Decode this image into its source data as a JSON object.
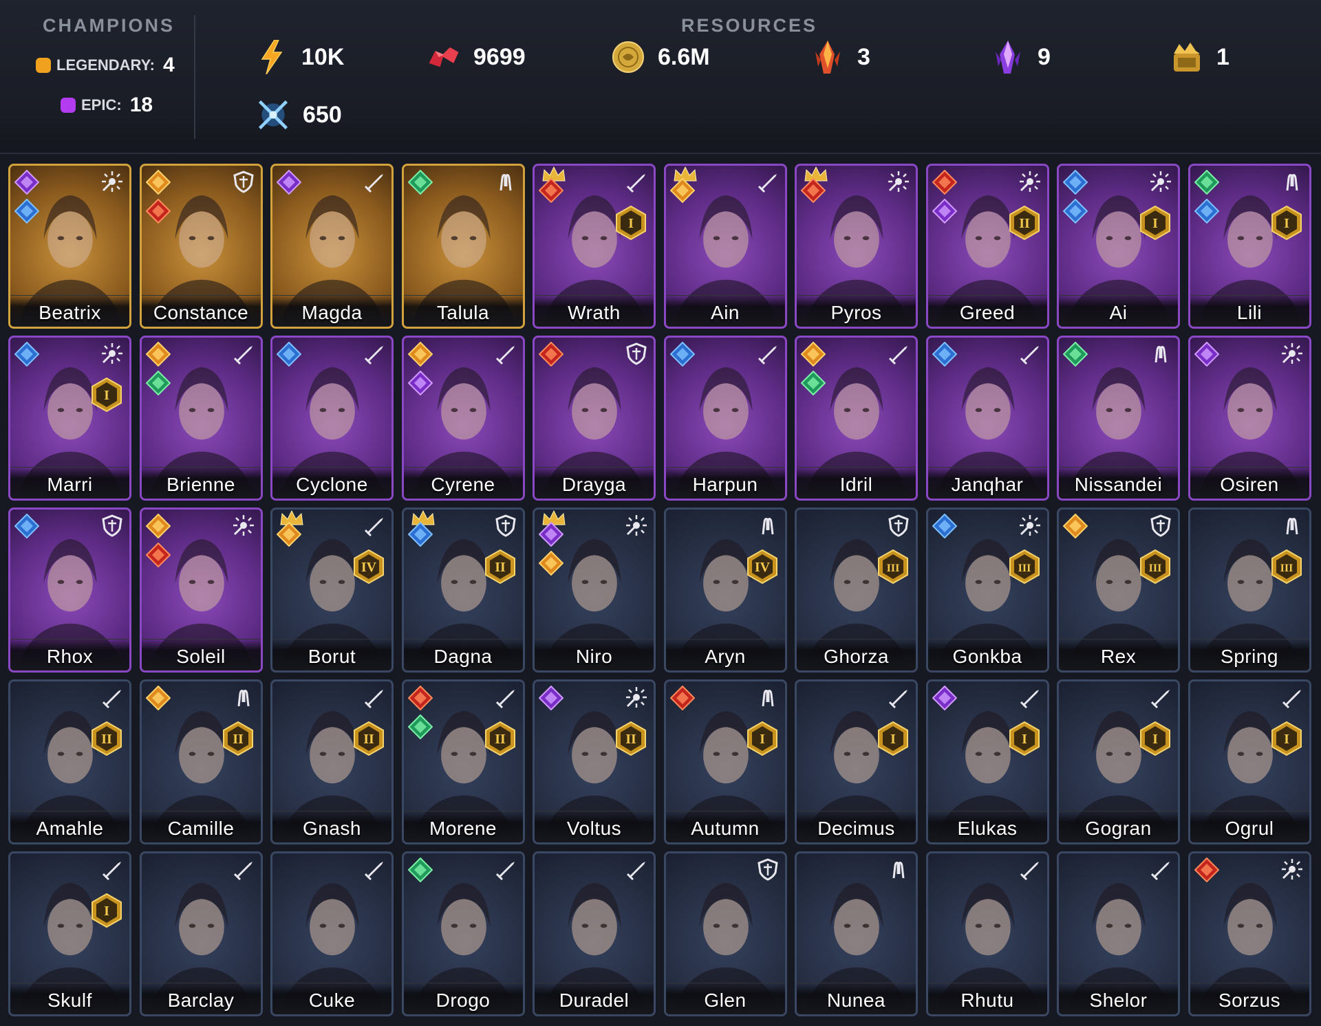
{
  "header": {
    "champions_label": "CHAMPIONS",
    "resources_label": "RESOURCES",
    "legendary": {
      "label": "LEGENDARY:",
      "count": "4",
      "color": "#f0a21e"
    },
    "epic": {
      "label": "EPIC:",
      "count": "18",
      "color": "#b43cf0"
    },
    "resources": [
      {
        "id": "energy",
        "icon": "energy-bolt-icon",
        "value": "10K"
      },
      {
        "id": "rubies",
        "icon": "ruby-gems-icon",
        "value": "9699"
      },
      {
        "id": "gold",
        "icon": "gold-coin-icon",
        "value": "6.6M"
      },
      {
        "id": "red-shard",
        "icon": "red-shard-icon",
        "value": "3"
      },
      {
        "id": "purple-shard",
        "icon": "purple-shard-icon",
        "value": "9"
      },
      {
        "id": "gold-token",
        "icon": "gold-token-icon",
        "value": "1"
      },
      {
        "id": "arena-tokens",
        "icon": "crossed-swords-icon",
        "value": "650"
      }
    ]
  },
  "champions": [
    {
      "name": "Beatrix",
      "rarity": "legendary",
      "role": "magic",
      "affinities": [
        "void",
        "magic"
      ],
      "rank": ""
    },
    {
      "name": "Constance",
      "rarity": "legendary",
      "role": "defense",
      "affinities": [
        "spirit",
        "force"
      ],
      "rank": ""
    },
    {
      "name": "Magda",
      "rarity": "legendary",
      "role": "attack",
      "affinities": [
        "void"
      ],
      "rank": ""
    },
    {
      "name": "Talula",
      "rarity": "legendary",
      "role": "support",
      "affinities": [
        "nature"
      ],
      "rank": ""
    },
    {
      "name": "Wrath",
      "rarity": "epic",
      "role": "attack",
      "affinities": [
        "force"
      ],
      "rank": "I",
      "crown": true
    },
    {
      "name": "Ain",
      "rarity": "epic",
      "role": "attack",
      "affinities": [
        "spirit"
      ],
      "rank": "",
      "crown": true
    },
    {
      "name": "Pyros",
      "rarity": "epic",
      "role": "magic",
      "affinities": [
        "force"
      ],
      "rank": "",
      "crown": true
    },
    {
      "name": "Greed",
      "rarity": "epic",
      "role": "magic",
      "affinities": [
        "force",
        "void"
      ],
      "rank": "II"
    },
    {
      "name": "Ai",
      "rarity": "epic",
      "role": "magic",
      "affinities": [
        "magic",
        "magic"
      ],
      "rank": "I"
    },
    {
      "name": "Lili",
      "rarity": "epic",
      "role": "support",
      "affinities": [
        "nature",
        "magic"
      ],
      "rank": "I"
    },
    {
      "name": "Marri",
      "rarity": "epic",
      "role": "magic",
      "affinities": [
        "magic"
      ],
      "rank": "I"
    },
    {
      "name": "Brienne",
      "rarity": "epic",
      "role": "attack",
      "affinities": [
        "spirit",
        "nature"
      ],
      "rank": ""
    },
    {
      "name": "Cyclone",
      "rarity": "epic",
      "role": "attack",
      "affinities": [
        "magic"
      ],
      "rank": ""
    },
    {
      "name": "Cyrene",
      "rarity": "epic",
      "role": "attack",
      "affinities": [
        "spirit",
        "void"
      ],
      "rank": ""
    },
    {
      "name": "Drayga",
      "rarity": "epic",
      "role": "defense",
      "affinities": [
        "force"
      ],
      "rank": ""
    },
    {
      "name": "Harpun",
      "rarity": "epic",
      "role": "attack",
      "affinities": [
        "magic"
      ],
      "rank": ""
    },
    {
      "name": "Idril",
      "rarity": "epic",
      "role": "attack",
      "affinities": [
        "spirit",
        "nature"
      ],
      "rank": ""
    },
    {
      "name": "Janqhar",
      "rarity": "epic",
      "role": "attack",
      "affinities": [
        "magic"
      ],
      "rank": ""
    },
    {
      "name": "Nissandei",
      "rarity": "epic",
      "role": "support",
      "affinities": [
        "nature"
      ],
      "rank": ""
    },
    {
      "name": "Osiren",
      "rarity": "epic",
      "role": "magic",
      "affinities": [
        "void"
      ],
      "rank": ""
    },
    {
      "name": "Rhox",
      "rarity": "epic",
      "role": "defense",
      "affinities": [
        "magic"
      ],
      "rank": ""
    },
    {
      "name": "Soleil",
      "rarity": "epic",
      "role": "magic",
      "affinities": [
        "spirit",
        "force"
      ],
      "rank": ""
    },
    {
      "name": "Borut",
      "rarity": "rare",
      "role": "attack",
      "affinities": [
        "spirit"
      ],
      "rank": "IV",
      "crown": true
    },
    {
      "name": "Dagna",
      "rarity": "rare",
      "role": "defense",
      "affinities": [
        "magic"
      ],
      "rank": "II",
      "crown": true
    },
    {
      "name": "Niro",
      "rarity": "rare",
      "role": "magic",
      "affinities": [
        "void",
        "spirit"
      ],
      "rank": "",
      "crown": true
    },
    {
      "name": "Aryn",
      "rarity": "rare",
      "role": "support",
      "affinities": [],
      "rank": "IV"
    },
    {
      "name": "Ghorza",
      "rarity": "rare",
      "role": "defense",
      "affinities": [],
      "rank": "III"
    },
    {
      "name": "Gonkba",
      "rarity": "rare",
      "role": "magic",
      "affinities": [
        "magic"
      ],
      "rank": "III"
    },
    {
      "name": "Rex",
      "rarity": "rare",
      "role": "defense",
      "affinities": [
        "spirit"
      ],
      "rank": "III"
    },
    {
      "name": "Spring",
      "rarity": "rare",
      "role": "support",
      "affinities": [],
      "rank": "III"
    },
    {
      "name": "Amahle",
      "rarity": "rare",
      "role": "attack",
      "affinities": [],
      "rank": "II"
    },
    {
      "name": "Camille",
      "rarity": "rare",
      "role": "support",
      "affinities": [
        "spirit"
      ],
      "rank": "II"
    },
    {
      "name": "Gnash",
      "rarity": "rare",
      "role": "attack",
      "affinities": [],
      "rank": "II"
    },
    {
      "name": "Morene",
      "rarity": "rare",
      "role": "attack",
      "affinities": [
        "force",
        "nature"
      ],
      "rank": "II"
    },
    {
      "name": "Voltus",
      "rarity": "rare",
      "role": "magic",
      "affinities": [
        "void"
      ],
      "rank": "II"
    },
    {
      "name": "Autumn",
      "rarity": "rare",
      "role": "support",
      "affinities": [
        "force"
      ],
      "rank": "I"
    },
    {
      "name": "Decimus",
      "rarity": "rare",
      "role": "attack",
      "affinities": [],
      "rank": "I"
    },
    {
      "name": "Elukas",
      "rarity": "rare",
      "role": "attack",
      "affinities": [
        "void"
      ],
      "rank": "I"
    },
    {
      "name": "Gogran",
      "rarity": "rare",
      "role": "attack",
      "affinities": [],
      "rank": "I"
    },
    {
      "name": "Ogrul",
      "rarity": "rare",
      "role": "attack",
      "affinities": [],
      "rank": "I"
    },
    {
      "name": "Skulf",
      "rarity": "rare",
      "role": "attack",
      "affinities": [],
      "rank": "I"
    },
    {
      "name": "Barclay",
      "rarity": "rare",
      "role": "attack",
      "affinities": [],
      "rank": ""
    },
    {
      "name": "Cuke",
      "rarity": "rare",
      "role": "attack",
      "affinities": [],
      "rank": ""
    },
    {
      "name": "Drogo",
      "rarity": "rare",
      "role": "attack",
      "affinities": [
        "nature"
      ],
      "rank": ""
    },
    {
      "name": "Duradel",
      "rarity": "rare",
      "role": "attack",
      "affinities": [],
      "rank": ""
    },
    {
      "name": "Glen",
      "rarity": "rare",
      "role": "defense",
      "affinities": [],
      "rank": ""
    },
    {
      "name": "Nunea",
      "rarity": "rare",
      "role": "support",
      "affinities": [],
      "rank": ""
    },
    {
      "name": "Rhutu",
      "rarity": "rare",
      "role": "attack",
      "affinities": [],
      "rank": ""
    },
    {
      "name": "Shelor",
      "rarity": "rare",
      "role": "attack",
      "affinities": [],
      "rank": ""
    },
    {
      "name": "Sorzus",
      "rarity": "rare",
      "role": "magic",
      "affinities": [
        "force"
      ],
      "rank": ""
    }
  ]
}
